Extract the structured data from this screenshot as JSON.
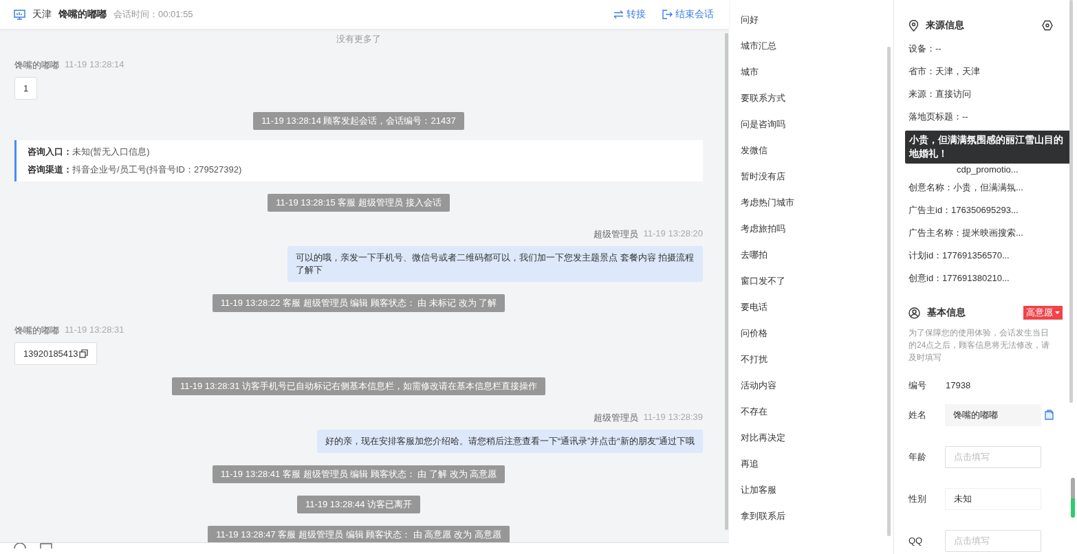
{
  "header": {
    "location": "天津",
    "customer": "馋嘴的嘟嘟",
    "duration": "会话时间：00:01:55",
    "actions": [
      {
        "kind": "transfer",
        "label": "转接"
      },
      {
        "kind": "end",
        "label": "结束会话"
      }
    ]
  },
  "messages": [
    {
      "kind": "end",
      "text": "没有更多了"
    },
    {
      "kind": "customer",
      "sender": "馋嘴的嘟嘟",
      "time": "11-19 13:28:14",
      "text": "1"
    },
    {
      "kind": "system",
      "text": "11-19 13:28:14 顾客发起会话，会话编号：21437"
    },
    {
      "kind": "entry",
      "lines": [
        {
          "label": "咨询入口：",
          "value": "未知(暂无入口信息)"
        },
        {
          "label": "咨询渠道：",
          "value": "抖音企业号/员工号(抖音号ID：279527392)"
        }
      ]
    },
    {
      "kind": "system",
      "text": "11-19 13:28:15 客服 超级管理员 接入会话"
    },
    {
      "kind": "agent",
      "sender": "超级管理员",
      "time": "11-19 13:28:20",
      "text": "可以的哦，亲发一下手机号、微信号或者二维码都可以，我们加一下您发主题景点 套餐内容 拍摄流程了解下"
    },
    {
      "kind": "system",
      "text": "11-19 13:28:22 客服 超级管理员 编辑 顾客状态： 由 未标记 改为 了解"
    },
    {
      "kind": "customer",
      "sender": "馋嘴的嘟嘟",
      "time": "11-19 13:28:31",
      "text": "13920185413",
      "copy": true
    },
    {
      "kind": "system",
      "text": "11-19 13:28:31 访客手机号已自动标记右侧基本信息栏，如需修改请在基本信息栏直接操作"
    },
    {
      "kind": "agent",
      "sender": "超级管理员",
      "time": "11-19 13:28:39",
      "text": "好的亲，现在安排客服加您介绍哈。请您稍后注意查看一下“通讯录”并点击“新的朋友”通过下哦"
    },
    {
      "kind": "system",
      "text": "11-19 13:28:41 客服 超级管理员 编辑 顾客状态： 由 了解 改为 高意愿"
    },
    {
      "kind": "system",
      "text": "11-19 13:28:44 访客已离开"
    },
    {
      "kind": "system",
      "text": "11-19 13:28:47 客服 超级管理员 编辑 顾客状态： 由 高意愿 改为 高意愿"
    }
  ],
  "quick_replies": [
    "问好",
    "城市汇总",
    "城市",
    "要联系方式",
    "问是咨询吗",
    "发微信",
    "暂时没有店",
    "考虑热门城市",
    "考虑旅拍吗",
    "去哪拍",
    "窗口发不了",
    "要电话",
    "问价格",
    "不打扰",
    "活动内容",
    "不存在",
    "对比再决定",
    "再追",
    "让加客服",
    "拿到联系后"
  ],
  "source_info": {
    "title": "来源信息",
    "fields": [
      "设备：--",
      "省市：天津，天津",
      "来源：直接访问",
      "落地页标题：--",
      "cdp_promotio...",
      "创意名称：小贵，但满满氛...",
      "广告主id：176350695293...",
      "广告主名称：提米映画搜索...",
      "计划id：177691356570...",
      "创意id：177691380210..."
    ],
    "tooltip": "小贵，但满满氛围感的丽江雪山目的地婚礼！"
  },
  "basic_info": {
    "title": "基本信息",
    "status": "高意愿",
    "notice": "为了保障您的使用体验，会话发生当日的24点之后，顾客信息将无法修改，请及时填写",
    "rows": [
      {
        "kind": "text",
        "label": "编号",
        "value": "17938"
      },
      {
        "kind": "readonly",
        "label": "姓名",
        "value": "馋嘴的嘟嘟",
        "copy": true
      },
      {
        "kind": "input",
        "label": "年龄",
        "placeholder": "点击填写"
      },
      {
        "kind": "select",
        "label": "性别",
        "value": "未知"
      },
      {
        "kind": "input",
        "label": "QQ",
        "placeholder": "点击填写"
      }
    ]
  }
}
